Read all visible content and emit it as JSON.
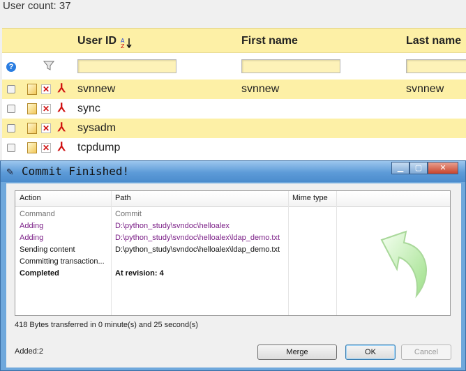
{
  "page": {
    "user_count": "User count: 37"
  },
  "grid": {
    "columns": [
      "User ID",
      "First name",
      "Last name"
    ],
    "rows": [
      {
        "user_id": "svnnew",
        "first": "svnnew",
        "last": "svnnew"
      },
      {
        "user_id": "sync",
        "first": "",
        "last": ""
      },
      {
        "user_id": "sysadm",
        "first": "",
        "last": ""
      },
      {
        "user_id": "tcpdump",
        "first": "",
        "last": ""
      }
    ]
  },
  "dialog": {
    "title": "Commit Finished!",
    "columns": [
      "Action",
      "Path",
      "Mime type"
    ],
    "rows": [
      {
        "action": "Command",
        "path": "Commit",
        "style": "gray"
      },
      {
        "action": "Adding",
        "path": "D:\\python_study\\svndoc\\helloalex",
        "style": "purple"
      },
      {
        "action": "Adding",
        "path": "D:\\python_study\\svndoc\\helloalex\\ldap_demo.txt",
        "style": "purple"
      },
      {
        "action": "Sending content",
        "path": "D:\\python_study\\svndoc\\helloalex\\ldap_demo.txt",
        "style": "black"
      },
      {
        "action": "Committing transaction...",
        "path": "",
        "style": "black"
      },
      {
        "action": "Completed",
        "path": "At revision: 4",
        "style": "bold"
      }
    ],
    "transfer_status": "418 Bytes transferred in 0 minute(s) and 25 second(s)",
    "added_status": "Added:2",
    "buttons": {
      "merge": "Merge",
      "ok": "OK",
      "cancel": "Cancel"
    }
  },
  "colors": {
    "header_yellow": "#fdf0a6",
    "purple": "#7b1f87",
    "gray": "#6e6e6e"
  }
}
